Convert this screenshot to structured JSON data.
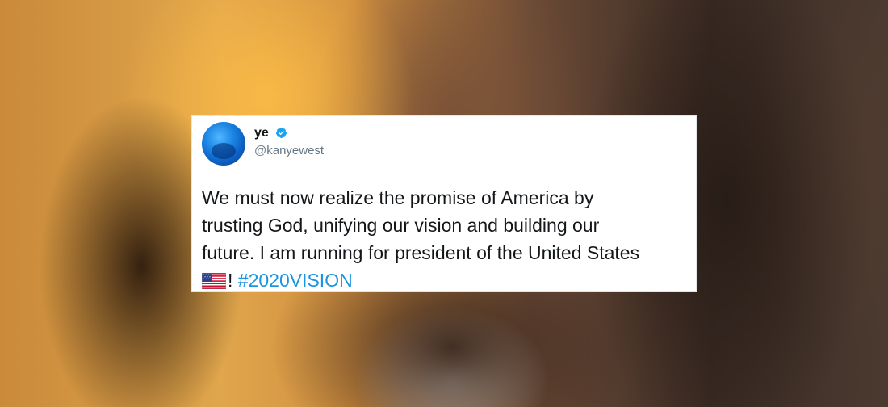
{
  "tweet": {
    "display_name": "ye",
    "handle": "@kanyewest",
    "text_line1": "We must now realize the promise of America by",
    "text_line2": "trusting God, unifying our vision and building our",
    "text_line3": "future. I am running for president of the United States",
    "exclamation": "!",
    "hashtag": "#2020VISION",
    "verified_icon": "verified-badge-icon",
    "flag_icon": "us-flag-emoji-icon",
    "colors": {
      "hashtag": "#1b95e0",
      "verified": "#1da1f2",
      "handle": "#657786"
    }
  }
}
